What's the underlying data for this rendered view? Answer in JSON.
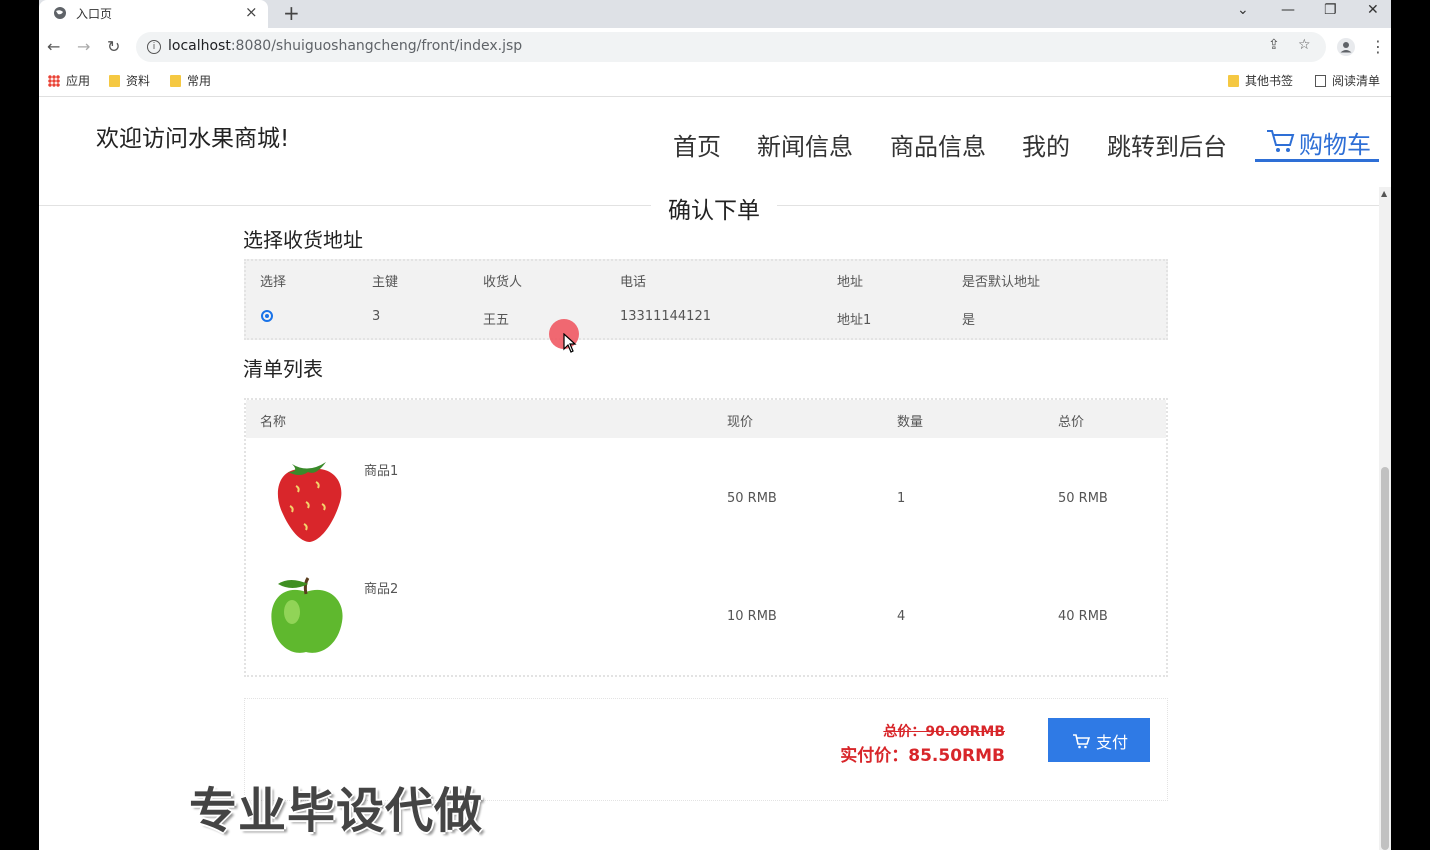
{
  "browser": {
    "tab_title": "入口页",
    "tab_close": "×",
    "new_tab": "+",
    "url_host": "localhost",
    "url_path": ":8080/shuiguoshangcheng/front/index.jsp",
    "bookmarks": [
      "应用",
      "资料",
      "常用"
    ],
    "other_bookmarks": "其他书签",
    "reading_list": "阅读清单"
  },
  "site": {
    "title": "欢迎访问水果商城!",
    "nav": [
      "首页",
      "新闻信息",
      "商品信息",
      "我的",
      "跳转到后台"
    ],
    "cart_label": "购物车"
  },
  "order": {
    "heading": "确认下单",
    "address_section": "选择收货地址",
    "address_columns": [
      "选择",
      "主键",
      "收货人",
      "电话",
      "地址",
      "是否默认地址"
    ],
    "address_rows": [
      {
        "selected": true,
        "id": "3",
        "receiver": "王五",
        "phone": "13311144121",
        "address": "地址1",
        "is_default": "是"
      }
    ],
    "list_section": "清单列表",
    "list_columns": [
      "名称",
      "现价",
      "数量",
      "总价"
    ],
    "items": [
      {
        "name": "商品1",
        "price": "50 RMB",
        "qty": "1",
        "total": "50 RMB",
        "image": "strawberry"
      },
      {
        "name": "商品2",
        "price": "10 RMB",
        "qty": "4",
        "total": "40 RMB",
        "image": "green-apple"
      }
    ],
    "total_original": "总价：90.00RMB",
    "total_paid": "实付价：85.50RMB",
    "pay_label": "支付"
  },
  "watermark": "专业毕设代做",
  "colors": {
    "accent": "#2e6fd6",
    "pay_button": "#2f7ae5",
    "price_red": "#d8262a"
  }
}
